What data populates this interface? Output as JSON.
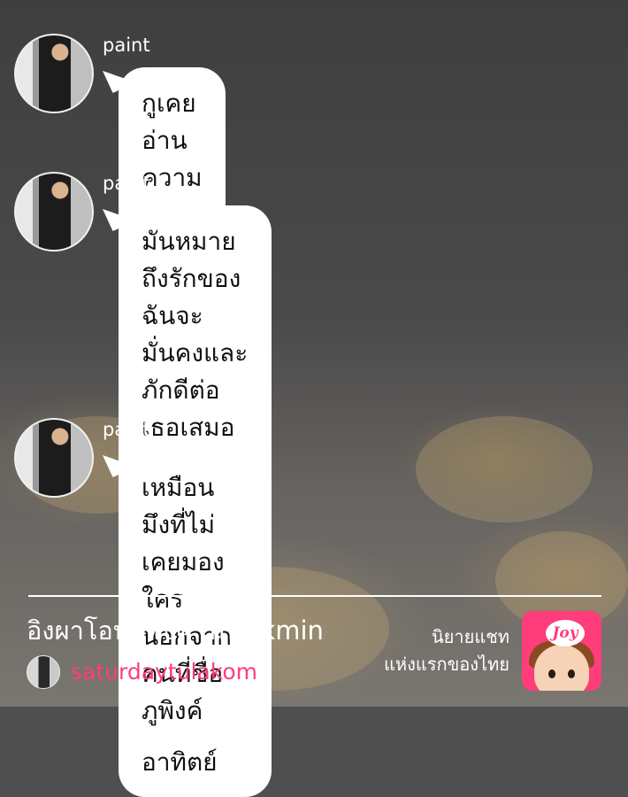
{
  "messages": [
    {
      "sender": "paint",
      "text": "กูเคยอ่านความหมายของมัน"
    },
    {
      "sender": "paint",
      "text": "มันหมายถึงรักของฉันจะมั่นคงและ\nภักดีต่อเธอเสมอ เหมือนกับดอก\nทานตะวันที่ไม่เคยหันไปมอง ใคร\nนอกจากดวงอาทิตย์"
    },
    {
      "sender": "paint",
      "text": "เหมือนมึงที่ไม่เคยมอง ใคร\nนอกจากคนที่ชื่อภูพิงค์"
    }
  ],
  "footer": {
    "story_title": "อิงผาโอบภูพิงค์ ,markmin",
    "author": "saturdaytulakom",
    "tagline_line1": "นิยายแชท",
    "tagline_line2": "แห่งแรกของไทย",
    "logo_text": "Joy"
  },
  "colors": {
    "bubble": "#ffffff",
    "author": "#ff3d7a",
    "logo_bg": "#ff3d7a"
  }
}
